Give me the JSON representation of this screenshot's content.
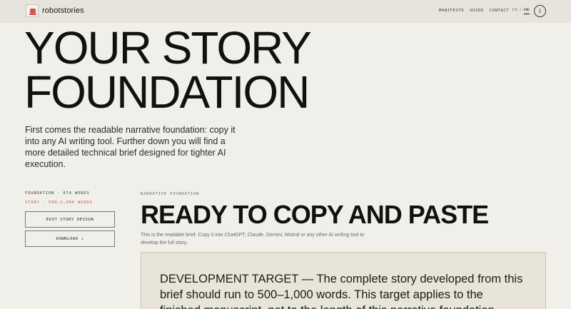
{
  "header": {
    "brand": "robotstories",
    "nav": [
      "MANIFESTO",
      "GUIDE",
      "CONTACT"
    ],
    "lang": [
      "ITA",
      "/",
      "ENG"
    ],
    "info_label": "i"
  },
  "hero": {
    "title_line1": "YOUR STORY",
    "title_line2": "FOUNDATION",
    "subtitle": "First comes the readable narrative foundation: copy it into any AI writing tool. Further down you will find a more detailed technical brief designed for tighter AI execution."
  },
  "sidebar": {
    "word_count": "FOUNDATION · 674 WORDS",
    "story_target": "STORY · 500–1,000 WORDS",
    "edit_button": "EDIT STORY DESIGN",
    "download_button": "DOWNLOAD ↓"
  },
  "main": {
    "section_label": "NARRATIVE FOUNDATION",
    "section_title": "READY TO COPY AND PASTE",
    "section_desc": "This is the readable brief. Copy it into ChatGPT, Claude, Gemini, Mistral or any other AI writing tool to develop the full story.",
    "brief_text": "DEVELOPMENT TARGET — The complete story developed from this brief should run to 500–1,000 words. This target applies to the finished manuscript, not to the length of this narrative foundation."
  },
  "colors": {
    "background": "#f1efe9",
    "header": "#e6e4dc",
    "accent": "#c25a4a",
    "brief_box": "#e8e4d8"
  }
}
